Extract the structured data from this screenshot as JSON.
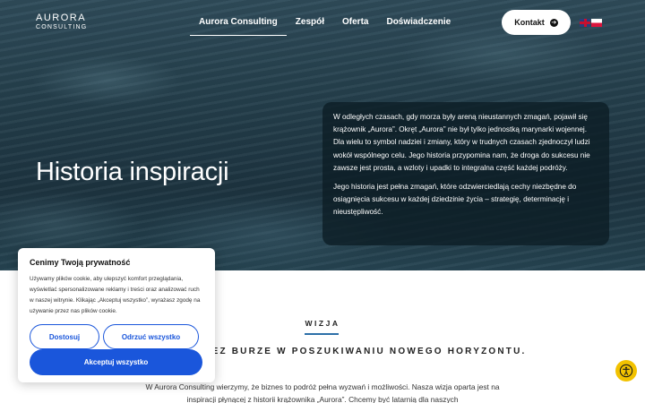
{
  "brand": {
    "line1": "AURORA",
    "line2": "CONSULTING"
  },
  "nav": {
    "items": [
      {
        "label": "Aurora Consulting",
        "active": true
      },
      {
        "label": "Zespół"
      },
      {
        "label": "Oferta"
      },
      {
        "label": "Doświadczenie"
      }
    ],
    "contact_label": "Kontakt",
    "languages": [
      "en",
      "pl"
    ]
  },
  "hero": {
    "title": "Historia inspiracji",
    "paragraph1": "W odległych czasach, gdy morza były areną nieustannych zmagań, pojawił się krążownik „Aurora”. Okręt „Aurora” nie był tylko jednostką marynarki wojennej. Dla wielu to symbol nadziei i zmiany, który w trudnych czasach zjednoczył ludzi wokół wspólnego celu. Jego historia przypomina nam, że droga do sukcesu nie zawsze jest prosta, a wzloty i upadki to integralna część każdej podróży.",
    "paragraph2": "Jego historia jest pełna zmagań, które odzwierciedlają cechy niezbędne do osiągnięcia sukcesu w każdej dziedzinie życia – strategię, determinację i nieustępliwość."
  },
  "vision": {
    "label": "WIZJA",
    "heading": "ZIMY PRZEZ BURZE W POSZUKIWANIU NOWEGO HORYZONTU.",
    "text": "W Aurora Consulting wierzymy, że biznes to podróż pełna wyzwań i możliwości. Nasza wizja oparta jest na inspiracji płynącej z historii krążownika „Aurora”. Chcemy być latarnią dla naszych"
  },
  "cookie": {
    "title": "Cenimy Twoją prywatność",
    "text": "Używamy plików cookie, aby ulepszyć komfort przeglądania, wyświetlać spersonalizowane reklamy i treści oraz analizować ruch w naszej witrynie. Klikając „Akceptuj wszystko”, wyrażasz zgodę na używanie przez nas plików cookie.",
    "customize": "Dostosuj",
    "reject": "Odrzuć wszystko",
    "accept": "Akceptuj wszystko"
  },
  "colors": {
    "accent": "#1a56db",
    "rule": "#2c6fa8",
    "a11y": "#f2c200"
  },
  "icons": {
    "contact": "arrow-right-circle-icon",
    "accessibility": "accessibility-icon"
  }
}
